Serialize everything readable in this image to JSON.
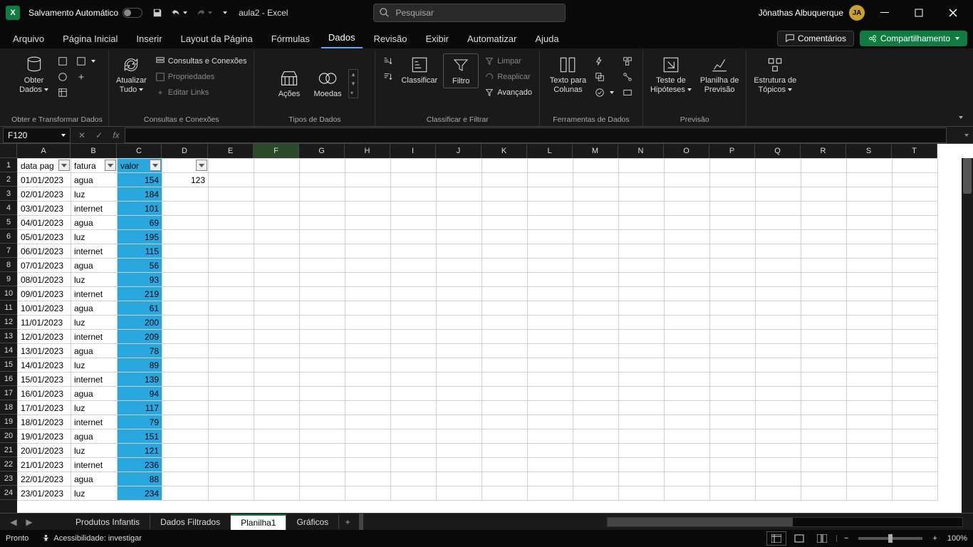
{
  "titlebar": {
    "autosave": "Salvamento Automático",
    "docname": "aula2 - Excel",
    "search_placeholder": "Pesquisar",
    "username": "Jônathas Albuquerque",
    "avatar": "JA"
  },
  "tabs": {
    "arquivo": "Arquivo",
    "pagina": "Página Inicial",
    "inserir": "Inserir",
    "layout": "Layout da Página",
    "formulas": "Fórmulas",
    "dados": "Dados",
    "revisao": "Revisão",
    "exibir": "Exibir",
    "automatizar": "Automatizar",
    "ajuda": "Ajuda",
    "comentarios": "Comentários",
    "compartilhar": "Compartilhamento"
  },
  "ribbon": {
    "g1": {
      "btn": "Obter\nDados",
      "label": "Obter e Transformar Dados"
    },
    "g2": {
      "btn": "Atualizar\nTudo",
      "i1": "Consultas e Conexões",
      "i2": "Propriedades",
      "i3": "Editar Links",
      "label": "Consultas e Conexões"
    },
    "g3": {
      "b1": "Ações",
      "b2": "Moedas",
      "label": "Tipos de Dados"
    },
    "g4": {
      "sort": "Classificar",
      "filter": "Filtro",
      "clear": "Limpar",
      "reapply": "Reaplicar",
      "adv": "Avançado",
      "label": "Classificar e Filtrar"
    },
    "g5": {
      "b1": "Texto para\nColunas",
      "label": "Ferramentas de Dados"
    },
    "g6": {
      "b1": "Teste de\nHipóteses",
      "b2": "Planilha de\nPrevisão",
      "label": "Previsão"
    },
    "g7": {
      "b1": "Estrutura de\nTópicos"
    }
  },
  "namebox": "F120",
  "columns": [
    "A",
    "B",
    "C",
    "D",
    "E",
    "F",
    "G",
    "H",
    "I",
    "J",
    "K",
    "L",
    "M",
    "N",
    "O",
    "P",
    "Q",
    "R",
    "S",
    "T"
  ],
  "headers": {
    "a": "data pag",
    "b": "fatura",
    "c": "valor"
  },
  "d2": "123",
  "rows": [
    {
      "n": 2,
      "a": "01/01/2023",
      "b": "agua",
      "c": "154"
    },
    {
      "n": 3,
      "a": "02/01/2023",
      "b": "luz",
      "c": "184"
    },
    {
      "n": 4,
      "a": "03/01/2023",
      "b": "internet",
      "c": "101"
    },
    {
      "n": 5,
      "a": "04/01/2023",
      "b": "agua",
      "c": "69"
    },
    {
      "n": 6,
      "a": "05/01/2023",
      "b": "luz",
      "c": "195"
    },
    {
      "n": 7,
      "a": "06/01/2023",
      "b": "internet",
      "c": "115"
    },
    {
      "n": 8,
      "a": "07/01/2023",
      "b": "agua",
      "c": "56"
    },
    {
      "n": 9,
      "a": "08/01/2023",
      "b": "luz",
      "c": "93"
    },
    {
      "n": 10,
      "a": "09/01/2023",
      "b": "internet",
      "c": "219"
    },
    {
      "n": 11,
      "a": "10/01/2023",
      "b": "agua",
      "c": "61"
    },
    {
      "n": 12,
      "a": "11/01/2023",
      "b": "luz",
      "c": "200"
    },
    {
      "n": 13,
      "a": "12/01/2023",
      "b": "internet",
      "c": "209"
    },
    {
      "n": 14,
      "a": "13/01/2023",
      "b": "agua",
      "c": "78"
    },
    {
      "n": 15,
      "a": "14/01/2023",
      "b": "luz",
      "c": "89"
    },
    {
      "n": 16,
      "a": "15/01/2023",
      "b": "internet",
      "c": "139"
    },
    {
      "n": 17,
      "a": "16/01/2023",
      "b": "agua",
      "c": "94"
    },
    {
      "n": 18,
      "a": "17/01/2023",
      "b": "luz",
      "c": "117"
    },
    {
      "n": 19,
      "a": "18/01/2023",
      "b": "internet",
      "c": "79"
    },
    {
      "n": 20,
      "a": "19/01/2023",
      "b": "agua",
      "c": "151"
    },
    {
      "n": 21,
      "a": "20/01/2023",
      "b": "luz",
      "c": "121"
    },
    {
      "n": 22,
      "a": "21/01/2023",
      "b": "internet",
      "c": "236"
    },
    {
      "n": 23,
      "a": "22/01/2023",
      "b": "agua",
      "c": "88"
    },
    {
      "n": 24,
      "a": "23/01/2023",
      "b": "luz",
      "c": "234"
    }
  ],
  "sheets": {
    "s1": "Produtos Infantis",
    "s2": "Dados Filtrados",
    "s3": "Planilha1",
    "s4": "Gráficos"
  },
  "status": {
    "ready": "Pronto",
    "access": "Acessibilidade: investigar",
    "zoom": "100%"
  }
}
